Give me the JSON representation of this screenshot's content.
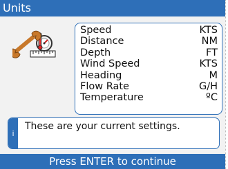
{
  "window": {
    "title": "Units"
  },
  "icon": {
    "name": "units-tools-icon"
  },
  "settings": [
    {
      "label": "Speed",
      "value": "KTS"
    },
    {
      "label": "Distance",
      "value": "NM"
    },
    {
      "label": "Depth",
      "value": "FT"
    },
    {
      "label": "Wind Speed",
      "value": "KTS"
    },
    {
      "label": "Heading",
      "value": "M"
    },
    {
      "label": "Flow Rate",
      "value": "G/H"
    },
    {
      "label": "Temperature",
      "value": "ºC"
    }
  ],
  "info": {
    "icon_glyph": "i",
    "message": "These are your current settings."
  },
  "footer": {
    "prompt": "Press ENTER to continue"
  },
  "colors": {
    "accent": "#2e6fb8",
    "background": "#f2f2f2"
  }
}
